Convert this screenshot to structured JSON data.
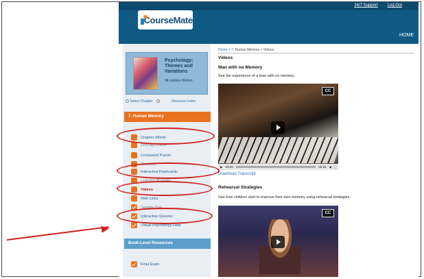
{
  "header": {
    "logo_text": "CourseMate",
    "links": [
      "24/7 Support",
      "Log Out"
    ],
    "home": "HOME"
  },
  "sidebar": {
    "book_title": "Psychology: Themes and Variations",
    "book_edition": "9th Edition Weiten",
    "select_chapter": "Select Chapter",
    "resource_index": "Resource Index",
    "chapter_header": "7. Human Memory",
    "items": [
      {
        "label": "Chapter eBook",
        "faded": false,
        "red": false
      },
      {
        "label": "Concept Check",
        "faded": true,
        "red": false
      },
      {
        "label": "Crossword Puzzle",
        "faded": false,
        "red": false
      },
      {
        "label": "Glossary",
        "faded": true,
        "red": false
      },
      {
        "label": "Interactive Flashcards",
        "faded": false,
        "red": false
      },
      {
        "label": "Learning Modules",
        "faded": true,
        "red": false
      },
      {
        "label": "Videos",
        "faded": false,
        "red": true
      },
      {
        "label": "Web Links",
        "faded": false,
        "red": false
      },
      {
        "label": "Sample Quiz",
        "faded": true,
        "red": false
      },
      {
        "label": "Interactive Quizzes",
        "faded": false,
        "red": false
      },
      {
        "label": "Virtual Psychology Labs",
        "faded": false,
        "red": false
      }
    ],
    "book_level_header": "Book-Level Resources",
    "final_exam": "Final Exam"
  },
  "main": {
    "breadcrumb_home": "Home",
    "breadcrumb_rest": " > 7. Human Memory > Videos",
    "heading": "Videos",
    "video1": {
      "title": "Man with no Memory",
      "desc": "See the experience of a man with no memory.",
      "cc": "CC",
      "time_start": "00:00",
      "time_end": "06:28"
    },
    "transcript": "Download Transcript",
    "video2": {
      "title": "Rehearsal Strategies",
      "desc": "See how children start to improve their own memory using rehearsal strategies.",
      "cc": "CC"
    }
  },
  "colors": {
    "header_blue": "#0f5a84",
    "accent_orange": "#e8731f",
    "annotation_red": "#d0201c"
  }
}
